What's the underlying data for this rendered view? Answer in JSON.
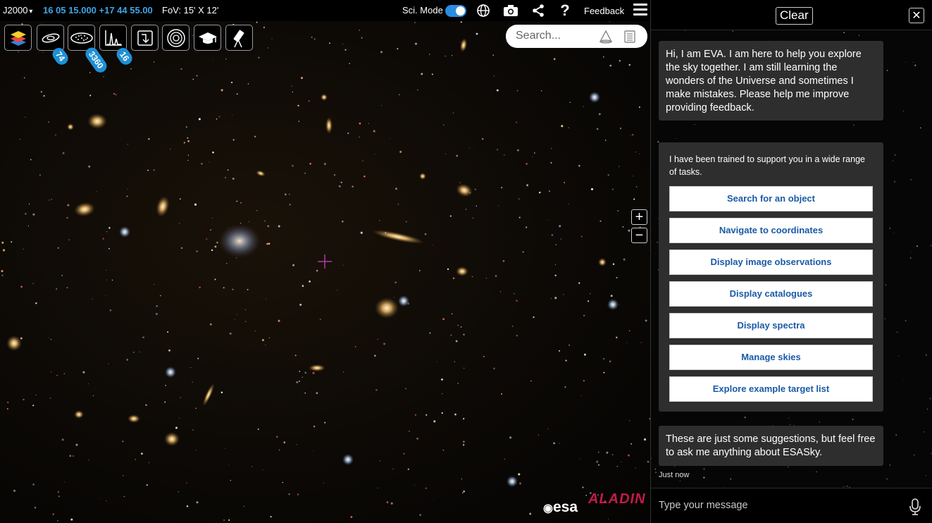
{
  "topbar": {
    "coord_frame": "J2000",
    "coordinates": "16 05 15.000 +17 44 55.00",
    "fov": "FoV: 15' X 12'",
    "sci_mode_label": "Sci. Mode",
    "sci_mode_on": true,
    "feedback_label": "Feedback"
  },
  "toolbar": {
    "badges": {
      "galaxies": "74",
      "catalogues": "3360",
      "spectra": "16"
    }
  },
  "search": {
    "placeholder": "Search..."
  },
  "zoom": {
    "in": "+",
    "out": "−"
  },
  "logos": {
    "esa": "esa",
    "aladin": "ALADIN"
  },
  "chat": {
    "clear_label": "Clear",
    "close_label": "✕",
    "welcome": "Hi, I am EVA. I am here to help you explore the sky together. I am still learning the wonders of the Universe and sometimes I make mistakes. Please help me improve providing feedback.",
    "intro": "I have been trained to support you in a wide range of tasks.",
    "suggestions": [
      "Search for an object",
      "Navigate to coordinates",
      "Display image observations",
      "Display catalogues",
      "Display spectra",
      "Manage skies",
      "Explore example target list"
    ],
    "closing": "These are just some suggestions, but feel free to ask me anything about ESASky.",
    "timestamp": "Just now",
    "input_placeholder": "Type your message"
  },
  "colors": {
    "accent": "#3fa4e6",
    "badge": "#1f8fd6",
    "link": "#1a5aa6",
    "crosshair": "#b03aa8"
  }
}
